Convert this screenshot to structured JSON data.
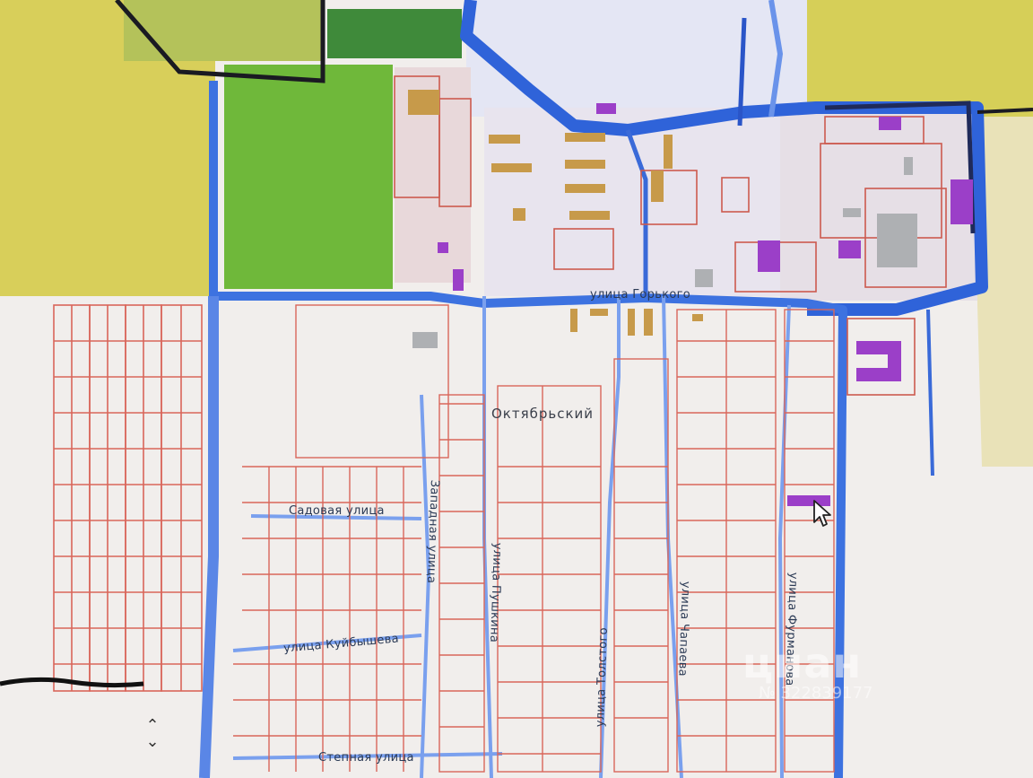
{
  "map": {
    "settlement": "Октябрьский",
    "streets": [
      {
        "id": "gorkogo",
        "label": "улица Горького"
      },
      {
        "id": "sadovaya",
        "label": "Садовая улица"
      },
      {
        "id": "zapadnaya",
        "label": "Западная улица"
      },
      {
        "id": "pushkina",
        "label": "улица Пушкина"
      },
      {
        "id": "tolstogo",
        "label": "улица Толстого"
      },
      {
        "id": "chapaeva",
        "label": "улица Чапаева"
      },
      {
        "id": "furmanova",
        "label": "улица Фурманова"
      },
      {
        "id": "kuybysheva",
        "label": "улица Куйбышева"
      },
      {
        "id": "stepnaya",
        "label": "Степная улица"
      }
    ],
    "colors": {
      "water": "#2f63d9",
      "parcel": "#d9665a",
      "building": "#9b3fc8",
      "field": "#c9c04a",
      "green": "#6fb83a"
    }
  },
  "watermark": {
    "brand": "циан",
    "code": "№ 322839177"
  },
  "controls": {
    "scroll_label": "⌃⌄"
  }
}
